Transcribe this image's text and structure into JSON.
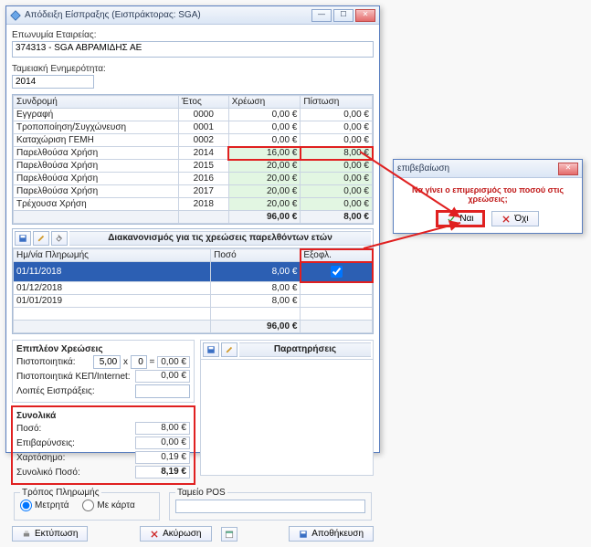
{
  "main_window": {
    "title": "Απόδειξη Είσπραξης (Εισπράκτορας: SGA)",
    "company_label": "Επωνυμία Εταιρείας:",
    "company_value": "374313 - SGA ΑΒΡΑΜΙΔΗΣ ΑΕ",
    "fiscal_label": "Ταμειακή Ενημερότητα:",
    "fiscal_value": "2014"
  },
  "subs_table": {
    "headers": [
      "Συνδρομή",
      "Έτος",
      "Χρέωση",
      "Πίστωση"
    ],
    "rows": [
      {
        "c0": "Εγγραφή",
        "c1": "0000",
        "c2": "0,00 €",
        "c3": "0,00 €",
        "green": false
      },
      {
        "c0": "Τροποποίηση/Συγχώνευση",
        "c1": "0001",
        "c2": "0,00 €",
        "c3": "0,00 €",
        "green": false
      },
      {
        "c0": "Καταχώριση ΓΕΜΗ",
        "c1": "0002",
        "c2": "0,00 €",
        "c3": "0,00 €",
        "green": false
      },
      {
        "c0": "Παρελθούσα Χρήση",
        "c1": "2014",
        "c2": "16,00 €",
        "c3": "8,00 €",
        "green": true,
        "hi": true
      },
      {
        "c0": "Παρελθούσα Χρήση",
        "c1": "2015",
        "c2": "20,00 €",
        "c3": "0,00 €",
        "green": true
      },
      {
        "c0": "Παρελθούσα Χρήση",
        "c1": "2016",
        "c2": "20,00 €",
        "c3": "0,00 €",
        "green": true
      },
      {
        "c0": "Παρελθούσα Χρήση",
        "c1": "2017",
        "c2": "20,00 €",
        "c3": "0,00 €",
        "green": true
      },
      {
        "c0": "Τρέχουσα Χρήση",
        "c1": "2018",
        "c2": "20,00 €",
        "c3": "0,00 €",
        "green": true
      }
    ],
    "totals": {
      "c2": "96,00 €",
      "c3": "8,00 €"
    }
  },
  "install": {
    "title": "Διακανονισμός για τις χρεώσεις παρελθόντων ετών",
    "headers": [
      "Ημ/νία Πληρωμής",
      "Ποσό",
      "Εξοφλ."
    ],
    "rows": [
      {
        "d": "01/11/2018",
        "a": "8,00 €",
        "p": true,
        "sel": true
      },
      {
        "d": "01/12/2018",
        "a": "8,00 €",
        "p": false
      },
      {
        "d": "01/01/2019",
        "a": "8,00 €",
        "p": false
      }
    ],
    "total": "96,00 €"
  },
  "extra": {
    "title": "Επιπλέον Χρεώσεις",
    "cert_label": "Πιστοποιητικά:",
    "cert_price": "5,00",
    "cert_qty": "0",
    "cert_total": "0,00 €",
    "kep_label": "Πιστοποιητικά ΚΕΠ/Internet:",
    "kep_total": "0,00 €",
    "other_label": "Λοιπές Εισπράξεις:"
  },
  "totals": {
    "title": "Συνολικά",
    "amount_label": "Ποσό:",
    "amount": "8,00 €",
    "surcharge_label": "Επιβαρύνσεις:",
    "surcharge": "0,00 €",
    "stamp_label": "Χαρτόσημο:",
    "stamp": "0,19 €",
    "grand_label": "Συνολικό Ποσό:",
    "grand": "8,19 €"
  },
  "notes": {
    "title": "Παρατηρήσεις"
  },
  "payment": {
    "title": "Τρόπος Πληρωμής",
    "cash": "Μετρητά",
    "card": "Με κάρτα",
    "pos_title": "Ταμείο POS"
  },
  "footer": {
    "print": "Εκτύπωση",
    "cancel": "Ακύρωση",
    "save": "Αποθήκευση"
  },
  "dialog": {
    "title": "επιβεβαίωση",
    "message": "Να γίνει ο επιμερισμός του ποσού στις χρεώσεις;",
    "yes": "Ναι",
    "no": "Όχι"
  }
}
